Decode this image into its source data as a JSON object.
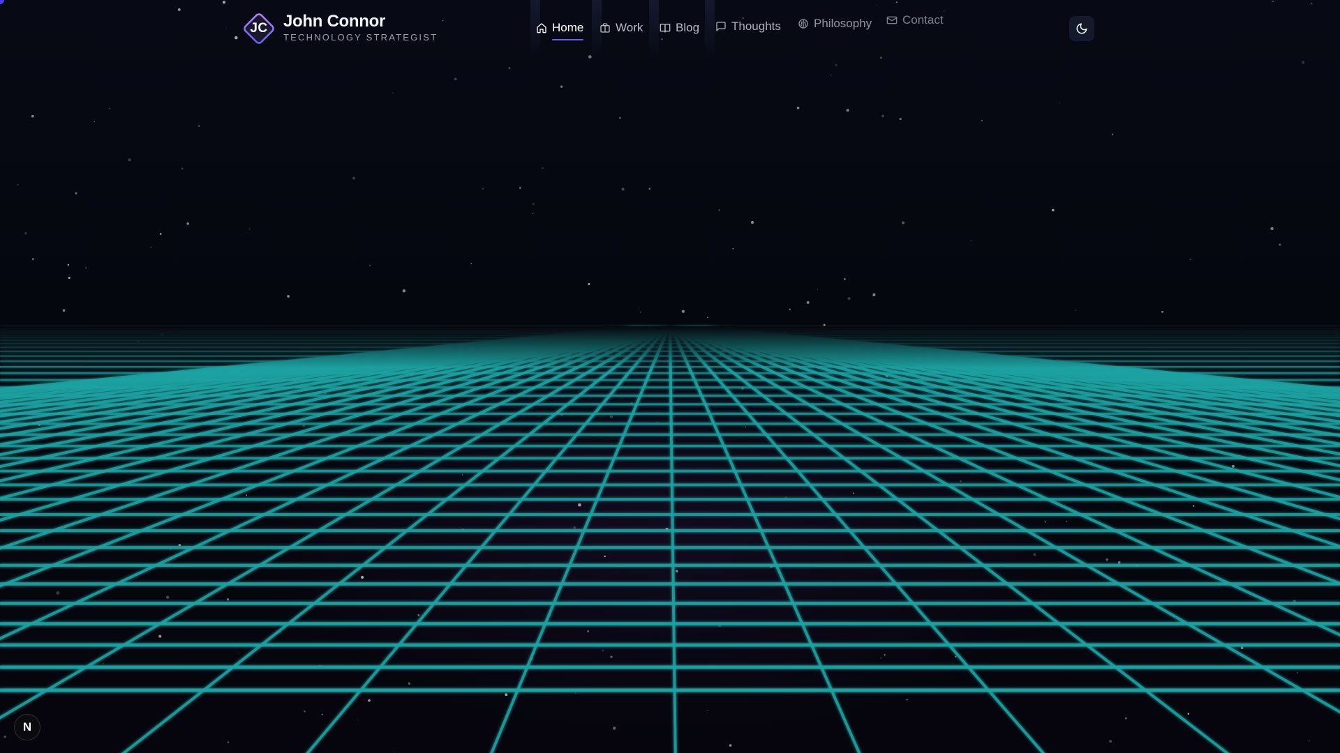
{
  "brand": {
    "monogram": "JC",
    "name": "John Connor",
    "subtitle": "TECHNOLOGY STRATEGIST"
  },
  "nav": {
    "items": [
      {
        "label": "Home",
        "icon": "home-icon",
        "active": true
      },
      {
        "label": "Work",
        "icon": "briefcase-icon",
        "active": false
      },
      {
        "label": "Blog",
        "icon": "book-icon",
        "active": false
      },
      {
        "label": "Thoughts",
        "icon": "message-square-icon",
        "active": false
      },
      {
        "label": "Philosophy",
        "icon": "brain-icon",
        "active": false
      },
      {
        "label": "Contact",
        "icon": "mail-icon",
        "active": false
      }
    ]
  },
  "theme_toggle": {
    "icon": "moon-icon"
  },
  "dev_badge": {
    "label": "N"
  },
  "colors": {
    "background": "#05070d",
    "grid": "#1fa3a3",
    "accent": "#6a5cff",
    "logo_gradient_start": "#a855f7",
    "logo_gradient_end": "#6366f1"
  }
}
